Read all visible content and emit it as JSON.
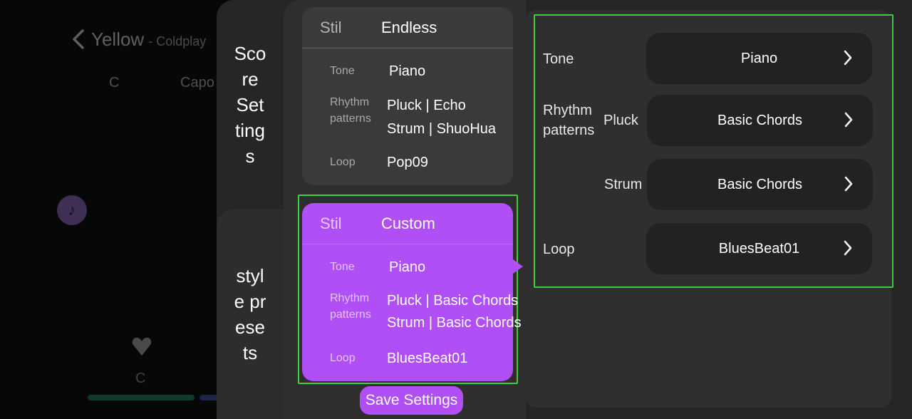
{
  "background": {
    "song_title": "Yellow",
    "artist": "- Coldplay",
    "key": "C",
    "capo": "Capo",
    "chord": "C"
  },
  "tabs": {
    "score_settings": "Score Settings",
    "style_presets": "style presets"
  },
  "presets": [
    {
      "style_key": "Stil",
      "style_name": "Endless",
      "tone_label": "Tone",
      "tone": "Piano",
      "rhythm_label_1": "Rhythm",
      "rhythm_label_2": "patterns",
      "rhythm_1": "Pluck | Echo",
      "rhythm_2": "Strum | ShuoHua",
      "loop_label": "Loop",
      "loop": "Pop09"
    },
    {
      "style_key": "Stil",
      "style_name": "Custom",
      "tone_label": "Tone",
      "tone": "Piano",
      "rhythm_label_1": "Rhythm",
      "rhythm_label_2": "patterns",
      "rhythm_1": "Pluck | Basic Chords",
      "rhythm_2": "Strum | Basic Chords",
      "loop_label": "Loop",
      "loop": "BluesBeat01"
    }
  ],
  "save_button": "Save Settings",
  "detail": {
    "tone_label": "Tone",
    "tone_value": "Piano",
    "rhythm_label_1": "Rhythm",
    "rhythm_label_2": "patterns",
    "pluck_label": "Pluck",
    "pluck_value": "Basic Chords",
    "strum_label": "Strum",
    "strum_value": "Basic Chords",
    "loop_label": "Loop",
    "loop_value": "BluesBeat01"
  },
  "colors": {
    "accent": "#b04ff5",
    "selection_outline": "#3fce3f",
    "panel": "#2f2f2f",
    "field": "#222222"
  }
}
